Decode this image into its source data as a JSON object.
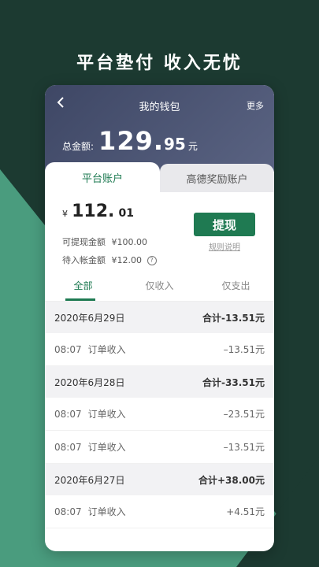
{
  "headline": "平台垫付 收入无忧",
  "wallet": {
    "title": "我的钱包",
    "more": "更多",
    "total_label": "总金额:",
    "total_int": "129.",
    "total_dec": "95",
    "total_unit": "元"
  },
  "tabs": [
    {
      "label": "平台账户"
    },
    {
      "label": "高德奖励账户"
    }
  ],
  "account": {
    "currency": "¥",
    "balance_int": "112.",
    "balance_dec": "01",
    "withdrawable_label": "可提现金额",
    "withdrawable_value": "¥100.00",
    "pending_label": "待入帐金额",
    "pending_value": "¥12.00",
    "withdraw_button": "提现",
    "rules_link": "规则说明"
  },
  "filters": [
    {
      "label": "全部"
    },
    {
      "label": "仅收入"
    },
    {
      "label": "仅支出"
    }
  ],
  "groups": [
    {
      "date": "2020年6月29日",
      "total": "合计-13.51元",
      "items": [
        {
          "time": "08:07",
          "desc": "订单收入",
          "amount": "–13.51元"
        }
      ]
    },
    {
      "date": "2020年6月28日",
      "total": "合计-33.51元",
      "items": [
        {
          "time": "08:07",
          "desc": "订单收入",
          "amount": "–23.51元"
        },
        {
          "time": "08:07",
          "desc": "订单收入",
          "amount": "–13.51元"
        }
      ]
    },
    {
      "date": "2020年6月27日",
      "total": "合计+38.00元",
      "items": [
        {
          "time": "08:07",
          "desc": "订单收入",
          "amount": "+4.51元"
        }
      ]
    }
  ]
}
